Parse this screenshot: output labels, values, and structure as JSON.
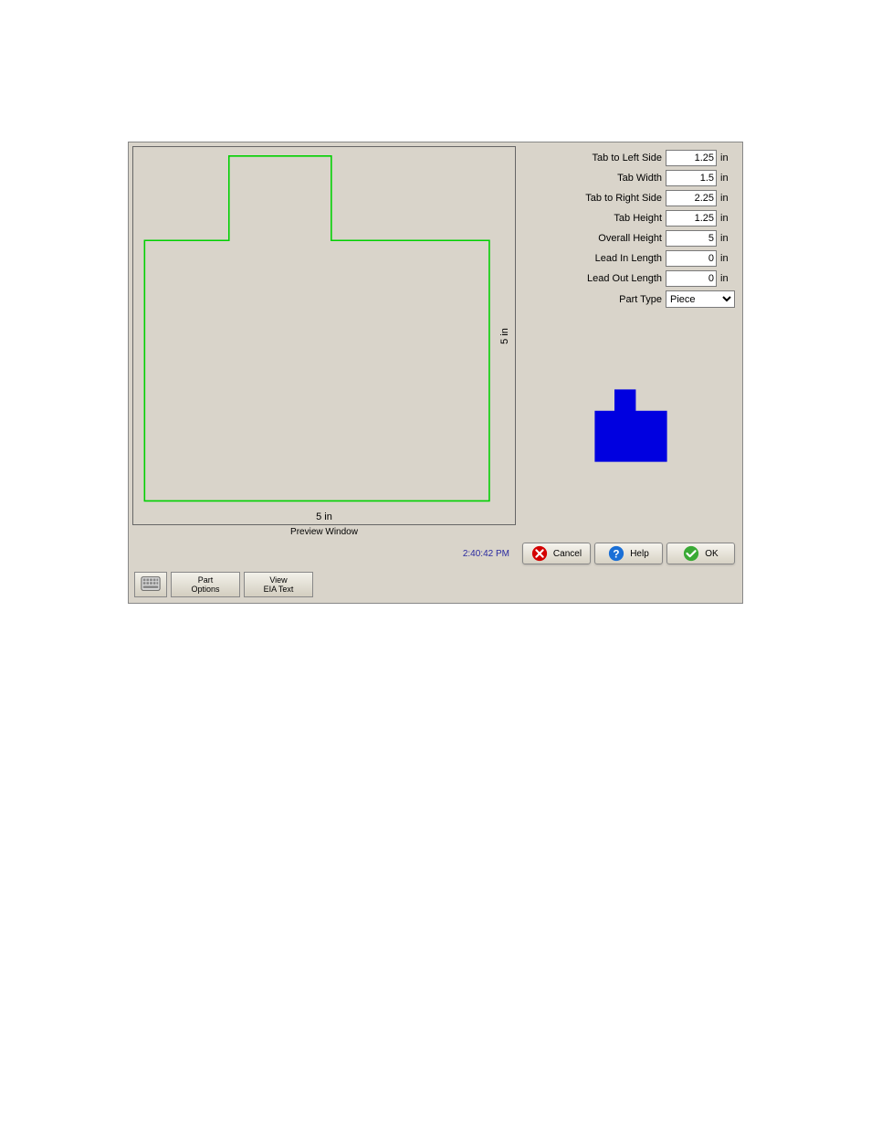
{
  "preview": {
    "caption": "Preview Window",
    "dim_x": "5 in",
    "dim_y": "5 in"
  },
  "params": {
    "tab_left_label": "Tab to Left Side",
    "tab_left_value": "1.25",
    "tab_width_label": "Tab Width",
    "tab_width_value": "1.5",
    "tab_right_label": "Tab to Right Side",
    "tab_right_value": "2.25",
    "tab_height_label": "Tab Height",
    "tab_height_value": "1.25",
    "overall_height_label": "Overall Height",
    "overall_height_value": "5",
    "lead_in_label": "Lead In Length",
    "lead_in_value": "0",
    "lead_out_label": "Lead Out Length",
    "lead_out_value": "0",
    "part_type_label": "Part Type",
    "part_type_value": "Piece",
    "unit": "in"
  },
  "footer": {
    "time": "2:40:42 PM",
    "cancel": "Cancel",
    "help": "Help",
    "ok": "OK"
  },
  "tools": {
    "part_options": "Part\nOptions",
    "view_eia": "View\nEIA Text"
  }
}
